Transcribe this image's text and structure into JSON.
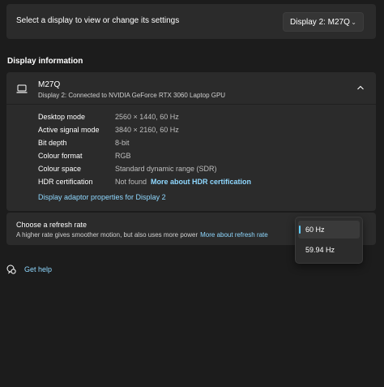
{
  "select_display": {
    "label": "Select a display to view or change its settings",
    "selected": "Display 2: M27Q"
  },
  "section_title": "Display information",
  "display_card": {
    "name": "M27Q",
    "subtitle": "Display 2: Connected to NVIDIA GeForce RTX 3060 Laptop GPU",
    "rows": [
      {
        "key": "Desktop mode",
        "value": "2560 × 1440, 60 Hz"
      },
      {
        "key": "Active signal mode",
        "value": "3840 × 2160, 60 Hz"
      },
      {
        "key": "Bit depth",
        "value": "8-bit"
      },
      {
        "key": "Colour format",
        "value": "RGB"
      },
      {
        "key": "Colour space",
        "value": "Standard dynamic range (SDR)"
      },
      {
        "key": "HDR certification",
        "value": "Not found",
        "link": "More about HDR certification"
      }
    ],
    "adaptor_link": "Display adaptor properties for Display 2"
  },
  "refresh_rate": {
    "title": "Choose a refresh rate",
    "subtitle": "A higher rate gives smoother motion, but also uses more power",
    "link": "More about refresh rate",
    "options": [
      "60 Hz",
      "59.94 Hz"
    ],
    "selected_index": 0
  },
  "help": {
    "label": "Get help"
  },
  "colors": {
    "accent": "#60cdff",
    "link": "#8fd8ff",
    "card": "#2b2b2b",
    "background": "#1c1c1c"
  }
}
